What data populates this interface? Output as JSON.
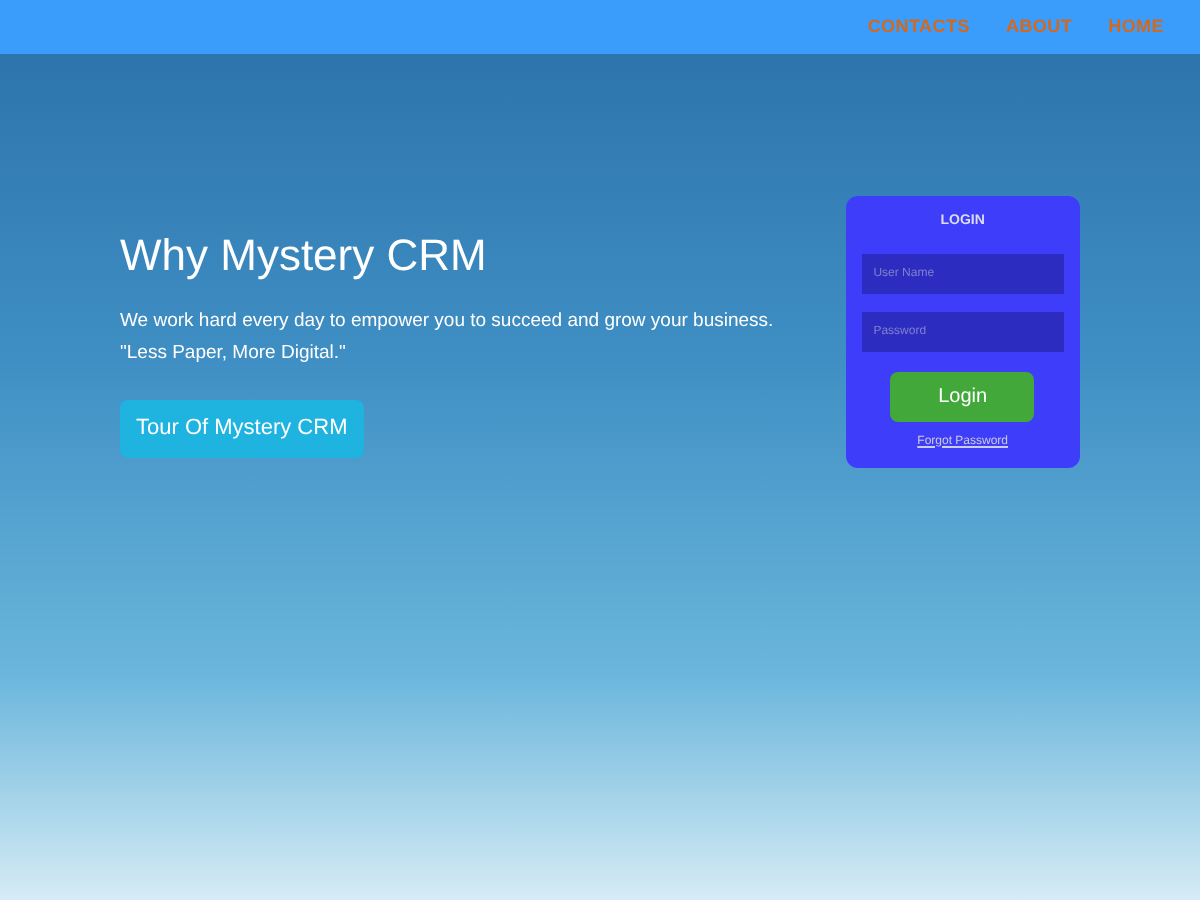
{
  "nav": {
    "links": [
      "CONTACTS",
      "ABOUT",
      "HOME"
    ]
  },
  "hero": {
    "title": "Why Mystery CRM",
    "lines": [
      "We work hard every day to empower you to succeed and grow your business.",
      "\"Less Paper, More Digital.\""
    ],
    "button": "Tour Of Mystery CRM"
  },
  "login": {
    "title": "LOGIN",
    "fields": [
      {
        "placeholder": "User Name"
      },
      {
        "placeholder": "Password"
      }
    ],
    "button": "Login",
    "link": "Forgot Password"
  }
}
